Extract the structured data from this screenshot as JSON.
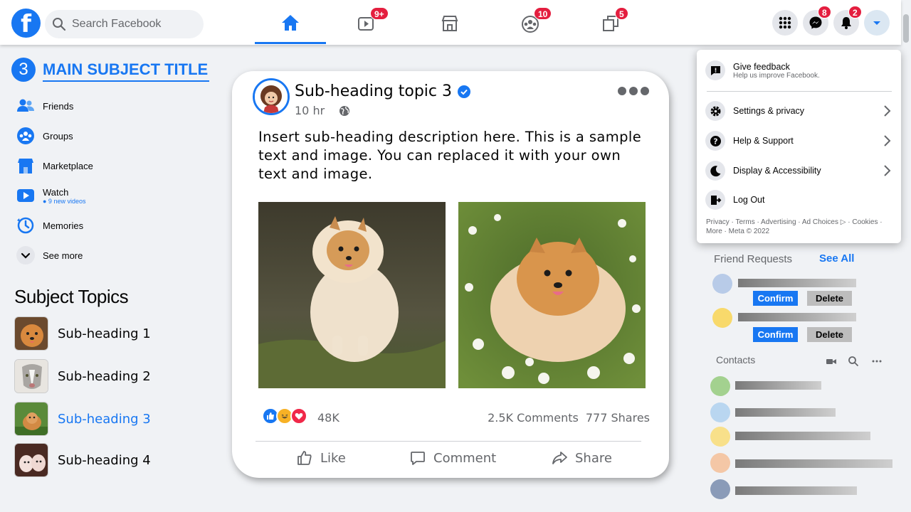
{
  "search": {
    "placeholder": "Search Facebook"
  },
  "nav": {
    "tabs": [
      {
        "name": "home",
        "badge": ""
      },
      {
        "name": "watch",
        "badge": "9+"
      },
      {
        "name": "marketplace",
        "badge": ""
      },
      {
        "name": "groups",
        "badge": "10"
      },
      {
        "name": "gaming",
        "badge": "5"
      }
    ],
    "messenger_badge": "8",
    "notifications_badge": "2"
  },
  "page": {
    "step": "3",
    "title": "MAIN SUBJECT TITLE"
  },
  "sidebar": {
    "items": [
      {
        "label": "Friends",
        "icon": "friends-icon"
      },
      {
        "label": "Groups",
        "icon": "groups-icon"
      },
      {
        "label": "Marketplace",
        "icon": "marketplace-icon"
      },
      {
        "label": "Watch",
        "sub": "● 9 new videos",
        "icon": "watch-icon"
      },
      {
        "label": "Memories",
        "icon": "memories-icon"
      },
      {
        "label": "See more",
        "icon": "chevron-down-icon"
      }
    ]
  },
  "topics": {
    "title": "Subject Topics",
    "items": [
      {
        "label": "Sub-heading 1"
      },
      {
        "label": "Sub-heading 2"
      },
      {
        "label": "Sub-heading 3",
        "active": true
      },
      {
        "label": "Sub-heading 4"
      }
    ]
  },
  "post": {
    "author": "Sub-heading topic 3",
    "time": "10 hr",
    "text": "Insert sub-heading description here. This is a sample text and image. You can replaced it with your own text and image.",
    "reaction_count": "48K",
    "comments": "2.5K Comments",
    "shares": "777 Shares",
    "actions": {
      "like": "Like",
      "comment": "Comment",
      "share": "Share"
    }
  },
  "menu": {
    "feedback": {
      "label": "Give feedback",
      "sub": "Help us improve Facebook."
    },
    "items": [
      {
        "label": "Settings & privacy"
      },
      {
        "label": "Help & Support"
      },
      {
        "label": "Display & Accessibility"
      },
      {
        "label": "Log Out"
      }
    ],
    "footer": "Privacy · Terms · Advertising · Ad Choices ▷ · Cookies · More · Meta © 2022"
  },
  "friend_requests": {
    "label": "Friend Requests",
    "see_all": "See All",
    "confirm": "Confirm",
    "delete": "Delete",
    "colors": [
      "#b8cbe8",
      "#f8d96b"
    ]
  },
  "contacts": {
    "label": "Contacts",
    "colors": [
      "#a3d18f",
      "#b9d6f0",
      "#f8e08a",
      "#f4c7a6",
      "#8a9bb8"
    ]
  },
  "colors": {
    "accent": "#1877f2",
    "badge": "#e41e3f"
  }
}
